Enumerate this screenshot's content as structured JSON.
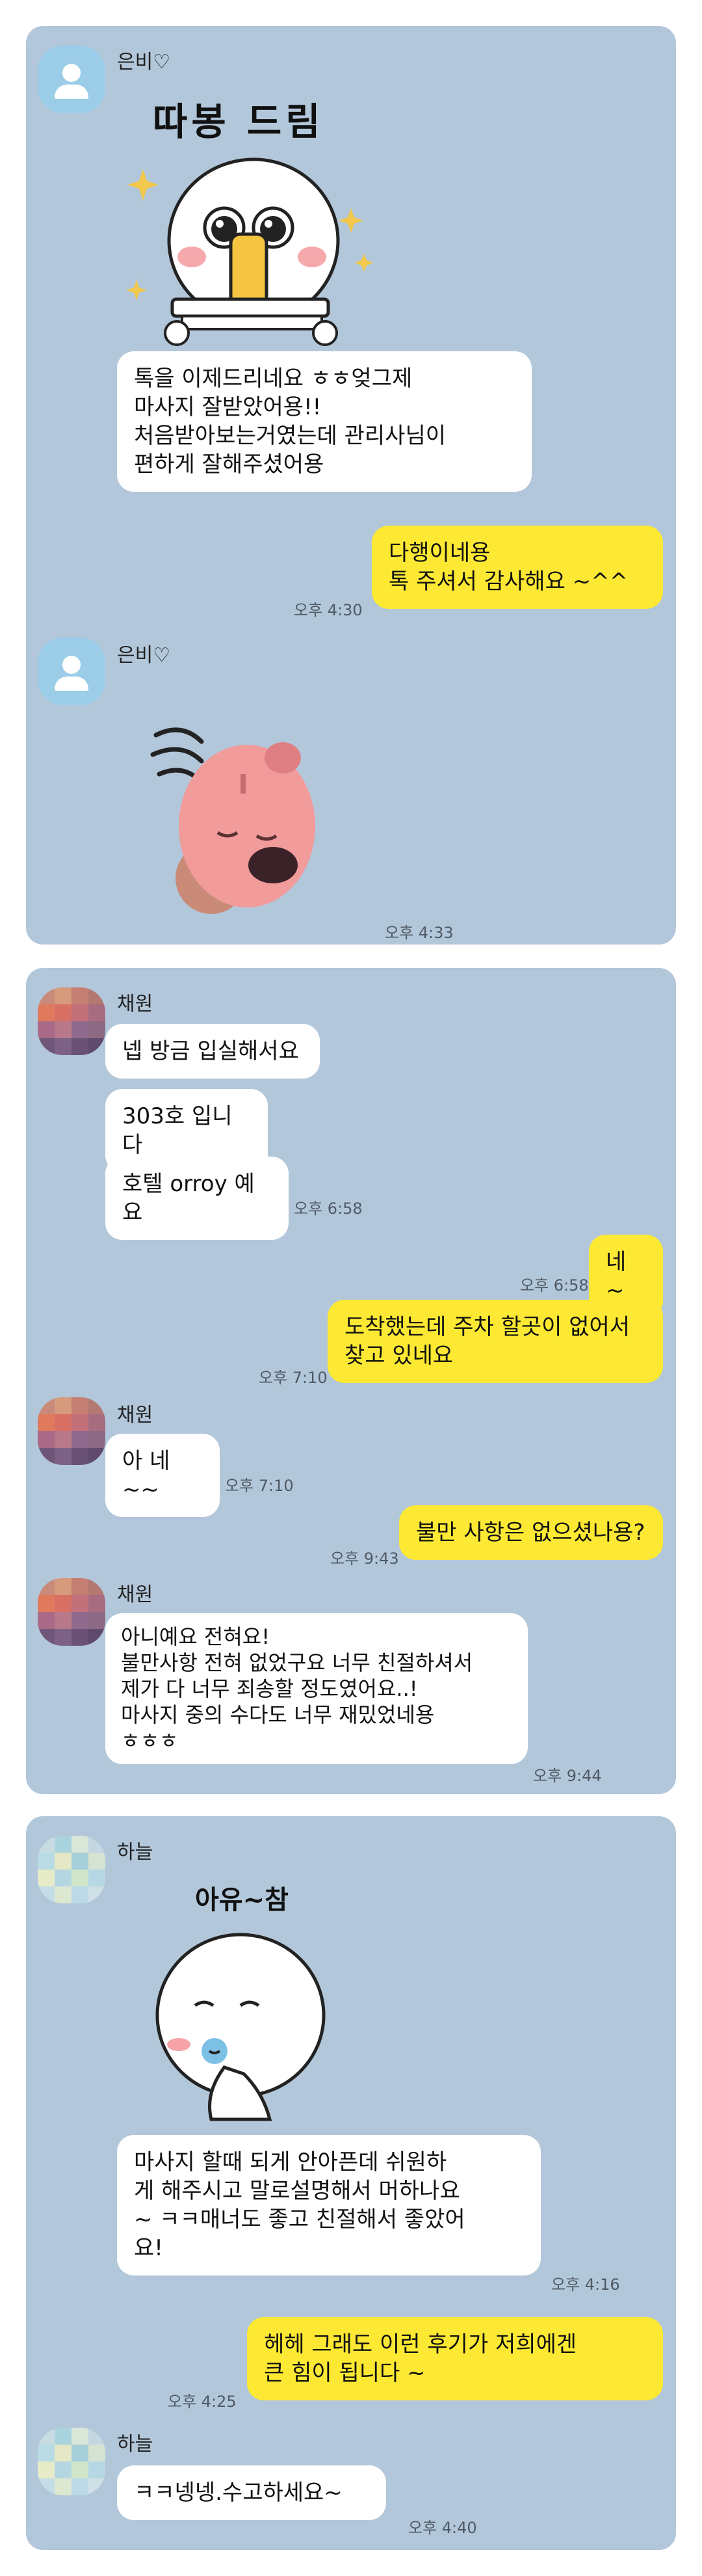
{
  "chat1": {
    "sender1": "은비♡",
    "sticker1_text": "따봉 드림",
    "msg1": "톡을 이제드리네요 ㅎㅎ엊그제\n마사지 잘받았어용!!\n처음받아보는거였는데 관리사님이\n편하게 잘해주셨어용",
    "reply1": "다행이네용\n톡 주셔서 감사해요 ~^^",
    "reply1_time": "오후 4:30",
    "sender2": "은비♡",
    "sticker2_time": "오후 4:33"
  },
  "chat2": {
    "sender": "채원",
    "msg1": "넵 방금 입실해서요",
    "msg2": "303호 입니다",
    "msg3": "호텔 orroy 예요",
    "msg3_time": "오후 6:58",
    "reply1": "네 ~",
    "reply1_time": "오후 6:58",
    "reply2": "도착했는데  주차 할곳이 없어서\n찾고 있네요",
    "reply2_time": "오후 7:10",
    "msg4": "아 네~~",
    "msg4_time": "오후 7:10",
    "reply3": "불만 사항은 없으셨나용?",
    "reply3_time": "오후 9:43",
    "msg5": "아니예요 전혀요!\n불만사항 전혀 없었구요 너무 친절하셔서\n제가 다 너무 죄송할 정도였어요..!\n마사지 중의 수다도 너무 재밌었네용\nㅎㅎㅎ",
    "msg5_time": "오후 9:44"
  },
  "chat3": {
    "sender": "하늘",
    "sticker_text": "아유~참",
    "msg1": "마사지 할때 되게 안아픈데 쉬원하\n게 해주시고 말로설명해서 머하나요\n~ ㅋㅋ매너도 좋고 친절해서 좋았어\n요!",
    "msg1_time": "오후 4:16",
    "reply1": "헤헤 그래도 이런 후기가 저희에겐\n큰 힘이 됩니다 ~",
    "reply1_time": "오후 4:25",
    "msg2": "ㅋㅋ넹넹.수고하세요~",
    "msg2_time": "오후 4:40"
  },
  "colors": {
    "chat_background": "#b2c7da",
    "my_bubble": "#fde933",
    "their_bubble": "#ffffff",
    "default_avatar": "#9bcde8"
  },
  "icons": [
    "default-profile-icon",
    "pixelated-profile-avatar",
    "sparkle-icon",
    "thumbs-up-sticker",
    "pink-beaver-sticker",
    "shy-face-sticker"
  ]
}
